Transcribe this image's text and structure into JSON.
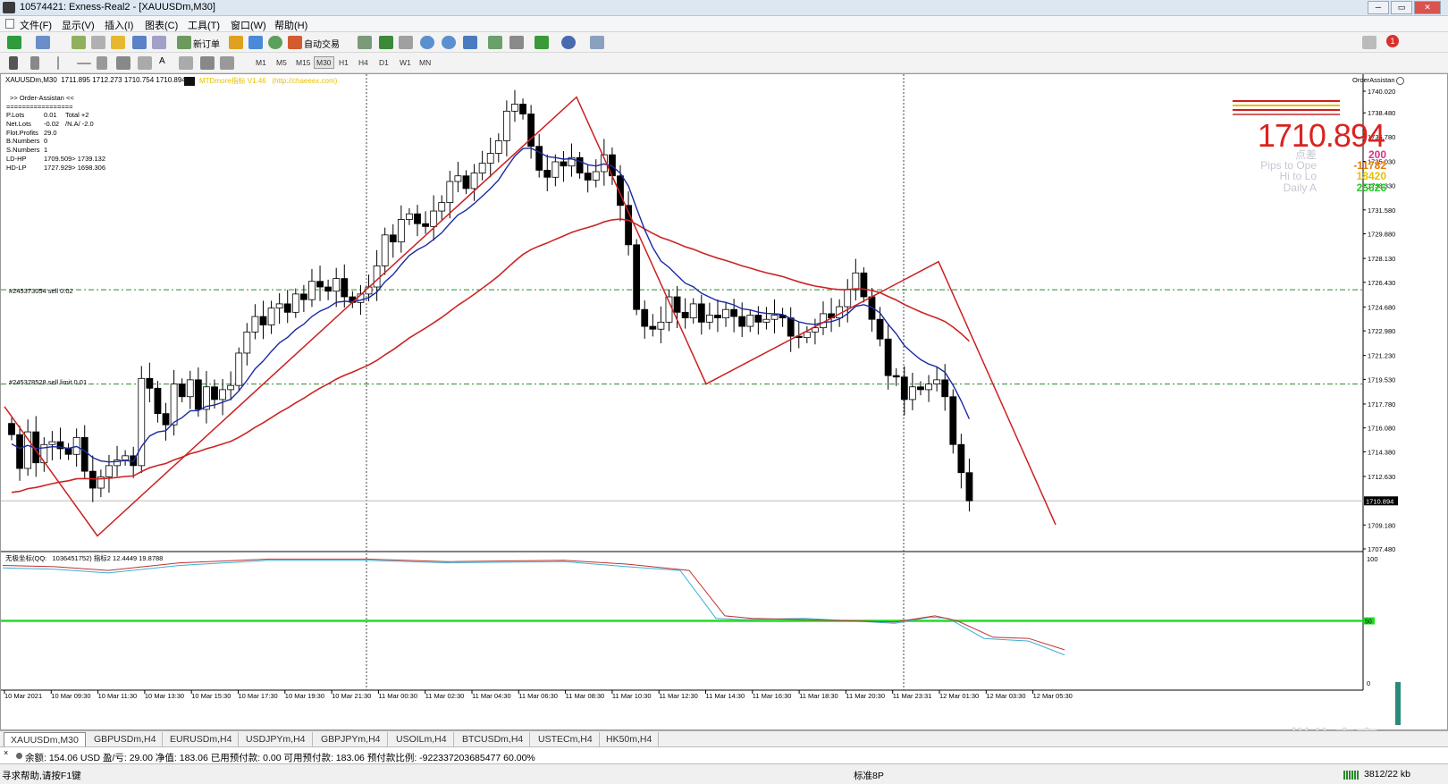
{
  "window": {
    "title": "10574421: Exness-Real2 - [XAUUSDm,M30]",
    "btn_min": "─",
    "btn_max": "▭",
    "btn_close": "✕"
  },
  "menu": [
    "文件(F)",
    "显示(V)",
    "插入(I)",
    "图表(C)",
    "工具(T)",
    "窗口(W)",
    "帮助(H)"
  ],
  "toolbar": {
    "new_order": "新订单",
    "auto_trade": "自动交易",
    "timeframes": [
      "M1",
      "M5",
      "M15",
      "M30",
      "H1",
      "H4",
      "D1",
      "W1",
      "MN"
    ],
    "active_tf": "M30",
    "notif_count": "1"
  },
  "chart": {
    "header": "XAUUSDm,M30  1711.895 1712.273 1710.754 1710.894",
    "indicator_name": "MTDmore指标 V1.46   (http://chaeeex.com)",
    "order_assistant_title": ">> Order-Assistan <<",
    "separator": "=================",
    "stats": [
      [
        "P.Lots",
        "0.01",
        "Total +2"
      ],
      [
        "Net.Lots",
        "-0.02",
        "/N.A/ -2.0"
      ],
      [
        "Flot.Profits",
        "29.0",
        ""
      ],
      [
        "B.Numbers",
        "0",
        ""
      ],
      [
        "S.Numbers",
        "1",
        ""
      ],
      [
        "LD-HP",
        "1709.509> 1739.132",
        ""
      ],
      [
        "HD-LP",
        "1727.929> 1698.306",
        ""
      ]
    ],
    "order_lines": [
      {
        "label": "#245373054 sell 0.02",
        "price": 1725.9
      },
      {
        "label": "#245378528 sell limit 0.01",
        "price": 1719.2
      }
    ],
    "order_assistant_label": "OrderAssistan",
    "big_price": "1710.894",
    "panel_rows": [
      [
        "点差",
        "200",
        "#d63384"
      ],
      [
        "Pips to Ope",
        "-11782",
        "#e87a00"
      ],
      [
        "Hi to Lo",
        "18420",
        "#e6c000"
      ],
      [
        "Daily A",
        "25626",
        "#22cc22"
      ]
    ],
    "price_axis": [
      "1740.020",
      "1738.480",
      "1736.780",
      "1735.030",
      "1733.330",
      "1731.580",
      "1729.880",
      "1728.130",
      "1726.430",
      "1724.680",
      "1722.980",
      "1721.230",
      "1719.530",
      "1717.780",
      "1716.080",
      "1714.380",
      "1712.630",
      "1710.894",
      "1709.180",
      "1707.480"
    ],
    "current_price_label": "1710.894",
    "time_axis": [
      "10 Mar 2021",
      "10 Mar 09:30",
      "10 Mar 11:30",
      "10 Mar 13:30",
      "10 Mar 15:30",
      "10 Mar 17:30",
      "10 Mar 19:30",
      "10 Mar 21:30",
      "11 Mar 00:30",
      "11 Mar 02:30",
      "11 Mar 04:30",
      "11 Mar 06:30",
      "11 Mar 08:30",
      "11 Mar 10:30",
      "11 Mar 12:30",
      "11 Mar 14:30",
      "11 Mar 16:30",
      "11 Mar 18:30",
      "11 Mar 20:30",
      "11 Mar 23:31",
      "12 Mar 01:30",
      "12 Mar 03:30",
      "12 Mar 05:30"
    ],
    "sub_header": "无极坐标(QQ:   1036451752) 指标2 12.4449 19.8788",
    "sub_axis": {
      "top": "100",
      "mid": "50",
      "bottom": "0"
    }
  },
  "tabs": [
    "XAUUSDm,M30",
    "GBPUSDm,H4",
    "EURUSDm,H4",
    "USDJPYm,H4",
    "GBPJPYm,H4",
    "USOILm,H4",
    "BTCUSDm,H4",
    "USTECm,H4",
    "HK50m,H4"
  ],
  "account": {
    "text": "余额: 154.06 USD  盈/亏: 29.00  净值: 183.06  已用预付款: 0.00  可用预付款: 183.06  预付款比例: -922337203685477 60.00%"
  },
  "statusbar": {
    "help": "寻求帮助,请按F1键",
    "profile": "标准8P",
    "traffic": "3812/22 kb"
  },
  "watermark": "@悦信泰壹"
}
